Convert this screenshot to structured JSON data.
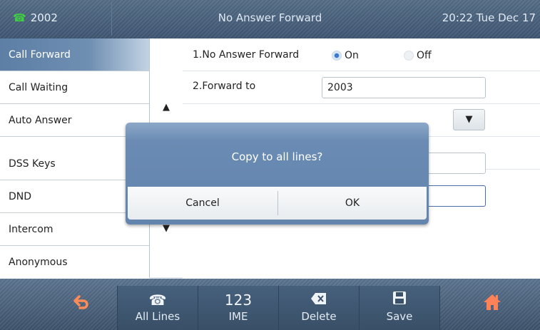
{
  "topbar": {
    "account": "2002",
    "title": "No Answer Forward",
    "clock": "20:22 Tue Dec 17"
  },
  "menu": {
    "items": [
      {
        "label": "Call Forward",
        "active": true
      },
      {
        "label": "Call Waiting",
        "active": false
      },
      {
        "label": "Auto Answer",
        "active": false
      },
      {
        "label": "DSS Keys",
        "active": false
      },
      {
        "label": "DND",
        "active": false
      },
      {
        "label": "Intercom",
        "active": false
      },
      {
        "label": "Anonymous",
        "active": false
      }
    ],
    "scroll_up": "▲",
    "scroll_down": "▼"
  },
  "settings": {
    "row1_label": "1.No Answer Forward",
    "on_label": "On",
    "off_label": "Off",
    "selected": "On",
    "row2_label": "2.Forward to",
    "forward_to_value": "2003",
    "dropdown_arrow": "▼"
  },
  "dialog": {
    "message": "Copy to all lines?",
    "cancel": "Cancel",
    "ok": "OK"
  },
  "softkeys": {
    "back_icon": "back-arrow-icon",
    "all_lines": "All Lines",
    "ime_number": "123",
    "ime": "IME",
    "delete": "Delete",
    "save": "Save",
    "home_icon": "home-icon"
  },
  "colors": {
    "accent_orange": "#ff8b57",
    "phone_green": "#3fd03f",
    "dialog_blue": "#6384ac",
    "bar_blue": "#4a6280"
  }
}
